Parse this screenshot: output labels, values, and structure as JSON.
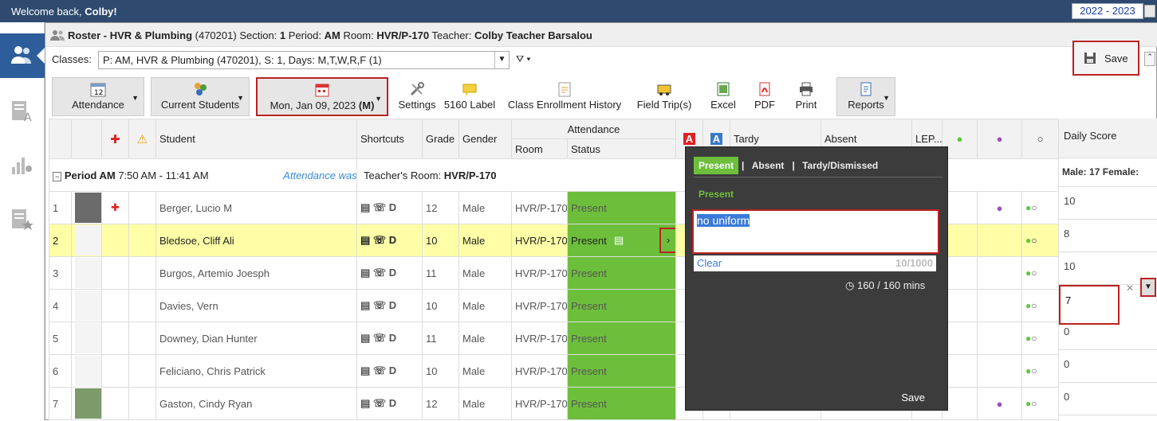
{
  "top": {
    "welcome_prefix": "Welcome back, ",
    "user": "Colby!",
    "year": "2022 - 2023"
  },
  "title": {
    "label": "Roster - HVR & Plumbing",
    "course_id": "(470201)",
    "section_label": "Section:",
    "section": "1",
    "period_label": "Period:",
    "period": "AM",
    "room_label": "Room:",
    "room": "HVR/P-170",
    "teacher_label": "Teacher:",
    "teacher": "Colby Teacher Barsalou"
  },
  "classes": {
    "label": "Classes:",
    "value": "P: AM, HVR & Plumbing (470201), S: 1, Days: M,T,W,R,F (1)"
  },
  "save_label": "Save",
  "toolbar": {
    "attendance": "Attendance",
    "current_students": "Current Students",
    "date": "Mon, Jan 09, 2023",
    "date_day": "(M)",
    "calendar_day": "12",
    "settings": "Settings",
    "label5160": "5160 Label",
    "class_enrollment": "Class Enrollment History",
    "field_trips": "Field Trip(s)",
    "excel": "Excel",
    "pdf": "PDF",
    "print": "Print",
    "reports": "Reports"
  },
  "columns": {
    "student": "Student",
    "shortcuts": "Shortcuts",
    "grade": "Grade",
    "gender": "Gender",
    "attendance": "Attendance",
    "room": "Room",
    "status": "Status",
    "tardy": "Tardy",
    "absent": "Absent",
    "lep": "LEP...",
    "daily_score": "Daily Score",
    "badge_a": "A"
  },
  "period": {
    "name": "Period AM",
    "time": "7:50 AM - 11:41 AM",
    "not_taken": "Attendance was not taken",
    "room_label": "Teacher's Room:",
    "room": "HVR/P-170",
    "male_label": "Male:",
    "male": "17",
    "female_label": "Female:"
  },
  "rows": [
    {
      "num": "1",
      "name": "Berger, Lucio M",
      "grade": "12",
      "gender": "Male",
      "room": "HVR/P-170",
      "status": "Present",
      "score": "10"
    },
    {
      "num": "2",
      "name": "Bledsoe, Cliff Ali",
      "grade": "10",
      "gender": "Male",
      "room": "HVR/P-170",
      "status": "Present",
      "score": "8"
    },
    {
      "num": "3",
      "name": "Burgos, Artemio Joesph",
      "grade": "11",
      "gender": "Male",
      "room": "HVR/P-170",
      "status": "Present",
      "score": "10"
    },
    {
      "num": "4",
      "name": "Davies, Vern",
      "grade": "10",
      "gender": "Male",
      "room": "HVR/P-170",
      "status": "Present",
      "score": "7"
    },
    {
      "num": "5",
      "name": "Downey, Dian Hunter",
      "grade": "11",
      "gender": "Male",
      "room": "HVR/P-170",
      "status": "Present",
      "score": "0"
    },
    {
      "num": "6",
      "name": "Feliciano, Chris Patrick",
      "grade": "10",
      "gender": "Male",
      "room": "HVR/P-170",
      "status": "Present",
      "score": "0"
    },
    {
      "num": "7",
      "name": "Gaston, Cindy Ryan",
      "grade": "12",
      "gender": "Male",
      "room": "HVR/P-170",
      "status": "Present",
      "score": "0"
    }
  ],
  "popup": {
    "tab_present": "Present",
    "tab_absent": "Absent",
    "tab_tardy": "Tardy/Dismissed",
    "heading": "Present",
    "note": "no uniform",
    "clear": "Clear",
    "count": "10/1000",
    "minutes": "160 / 160 mins",
    "save": "Save"
  },
  "colors": {
    "present": "#6dbf3b",
    "header": "#2f4a6e",
    "highlight": "#b22222",
    "selected_row": "#ffffa8"
  }
}
